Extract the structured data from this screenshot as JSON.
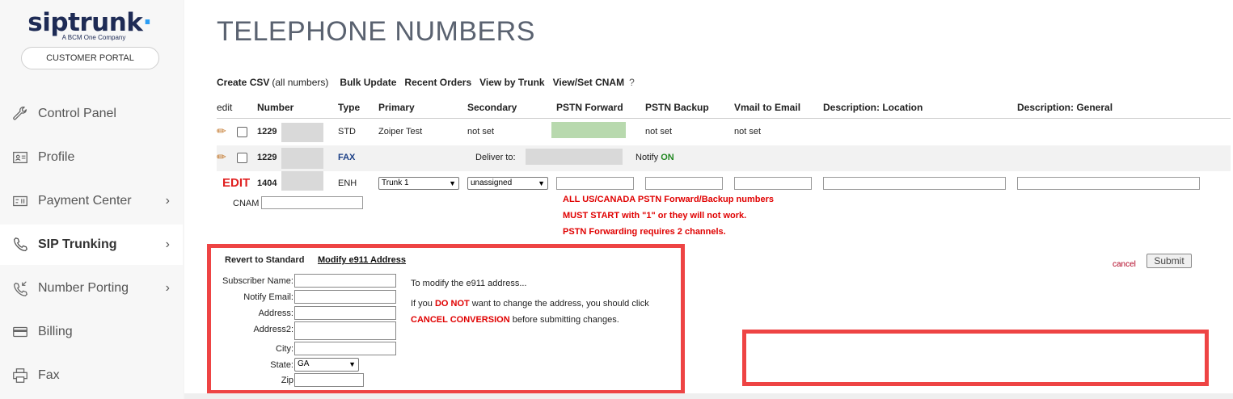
{
  "brand": {
    "name_sip": "sip",
    "name_trunk": "trunk",
    "tagline": "A BCM One Company",
    "portal_button": "CUSTOMER PORTAL"
  },
  "sidebar": {
    "items": [
      {
        "label": "Control Panel",
        "icon": "wrench-icon"
      },
      {
        "label": "Profile",
        "icon": "id-card-icon"
      },
      {
        "label": "Payment Center",
        "icon": "payment-icon",
        "chevron": "›"
      },
      {
        "label": "SIP Trunking",
        "icon": "phone-icon",
        "chevron": "›",
        "active": true
      },
      {
        "label": "Number Porting",
        "icon": "porting-icon",
        "chevron": "›"
      },
      {
        "label": "Billing",
        "icon": "billing-icon"
      },
      {
        "label": "Fax",
        "icon": "printer-icon"
      }
    ]
  },
  "page": {
    "title": "TELEPHONE NUMBERS"
  },
  "toolbar": {
    "create_csv": "Create CSV",
    "create_csv_sub": "(all numbers)",
    "bulk_update": "Bulk Update",
    "recent_orders": "Recent Orders",
    "view_by_trunk": "View by Trunk",
    "view_cnam": "View/Set CNAM",
    "help": "?"
  },
  "table": {
    "headers": {
      "edit": "edit",
      "number": "Number",
      "type": "Type",
      "primary": "Primary",
      "secondary": "Secondary",
      "pstn_forward": "PSTN Forward",
      "pstn_backup": "PSTN Backup",
      "vmail": "Vmail to Email",
      "desc_location": "Description: Location",
      "desc_general": "Description: General"
    },
    "row1": {
      "number": "1229",
      "type": "STD",
      "primary": "Zoiper Test",
      "secondary": "not set",
      "pstn_backup": "not set",
      "vmail": "not set"
    },
    "row2": {
      "number": "1229",
      "type": "FAX",
      "deliver_to": "Deliver to:",
      "notify": "Notify",
      "notify_status": "ON"
    },
    "row3": {
      "edit_label": "EDIT",
      "number": "1404",
      "type": "ENH",
      "primary_selected": "Trunk 1",
      "secondary_selected": "unassigned",
      "cnam_label": "CNAM"
    }
  },
  "warnings": [
    "ALL US/CANADA PSTN Forward/Backup numbers",
    "MUST START with \"1\" or they will not work.",
    "PSTN Forwarding requires 2 channels."
  ],
  "e911": {
    "revert": "Revert to Standard",
    "modify": "Modify e911 Address",
    "fields": {
      "subscriber": "Subscriber Name:",
      "notify_email": "Notify Email:",
      "address": "Address:",
      "address2": "Address2:",
      "city": "City:",
      "state": "State:",
      "zip": "Zip"
    },
    "state_selected": "GA",
    "info_line1": "To modify the e911 address...",
    "info_line2_a": "If you ",
    "info_line2_b": "DO NOT",
    "info_line2_c": " want to change the address, you should click",
    "info_line3_a": "CANCEL CONVERSION",
    "info_line3_b": " before submitting changes."
  },
  "actions": {
    "cancel": "cancel",
    "submit": "Submit"
  },
  "colors": {
    "highlight": "#ee4444",
    "warning": "#e00000",
    "accent": "#2a9df4"
  }
}
